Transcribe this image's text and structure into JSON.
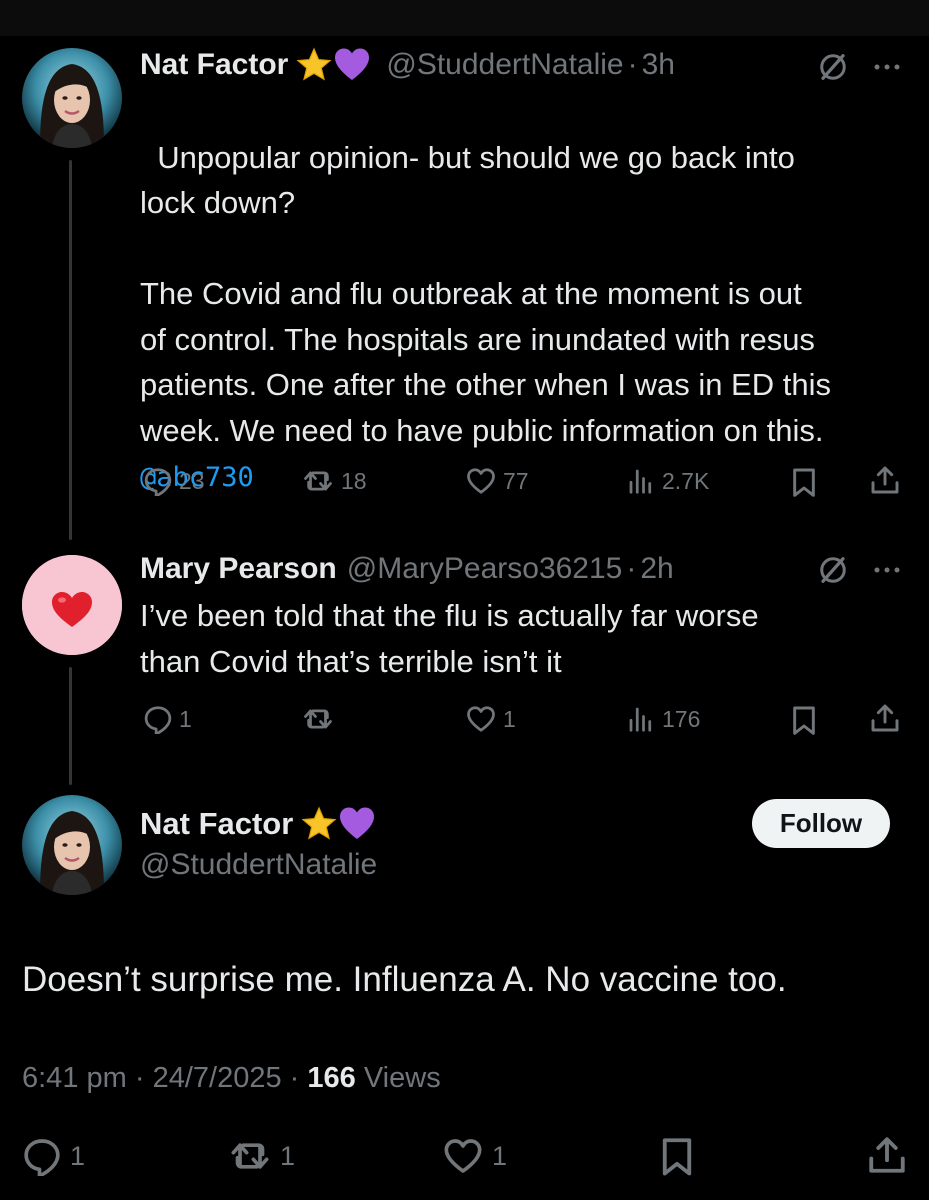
{
  "tweet1": {
    "name": "Nat Factor",
    "handle": "@StuddertNatalie",
    "separator": "·",
    "time": "3h",
    "text": "Unpopular opinion- but should we go back into\nlock down?\n\nThe Covid and flu outbreak at the moment is out\nof control. The hospitals are inundated with resus\npatients. One after the other when I was in ED this\nweek. We need to have public information on this.",
    "mention": "@abc730",
    "replies": "23",
    "retweets": "18",
    "likes": "77",
    "views": "2.7K"
  },
  "tweet2": {
    "name": "Mary Pearson",
    "handle": "@MaryPearso36215",
    "separator": "·",
    "time": "2h",
    "text": "I’ve been told that the flu is actually far worse\nthan Covid that’s terrible isn’t it",
    "replies": "1",
    "retweets": "",
    "likes": "1",
    "views": "176"
  },
  "focus_tweet": {
    "name": "Nat Factor",
    "handle": "@StuddertNatalie",
    "follow_label": "Follow",
    "text": "Doesn’t surprise me. Influenza A. No vaccine too.",
    "time": "6:41 pm",
    "date": "24/7/2025",
    "separator": "·",
    "views_count": "166",
    "views_label": "Views",
    "replies": "1",
    "retweets": "1",
    "likes": "1"
  },
  "colors": {
    "background": "#000000",
    "text_primary": "#e7e9ea",
    "text_secondary": "#71767b",
    "link": "#1d9bf0",
    "follow_button_bg": "#eff3f4",
    "heart_emoji": "#e0202c",
    "purple_heart": "#a05ad8",
    "star": "#f5c518"
  },
  "icons": {
    "badge_star": "star-emoji",
    "badge_heart": "purple-heart-emoji",
    "reply": "reply-icon",
    "retweet": "retweet-icon",
    "like": "like-icon",
    "views": "views-icon",
    "bookmark": "bookmark-icon",
    "share": "share-icon",
    "grok": "grok-icon",
    "more": "more-icon"
  }
}
